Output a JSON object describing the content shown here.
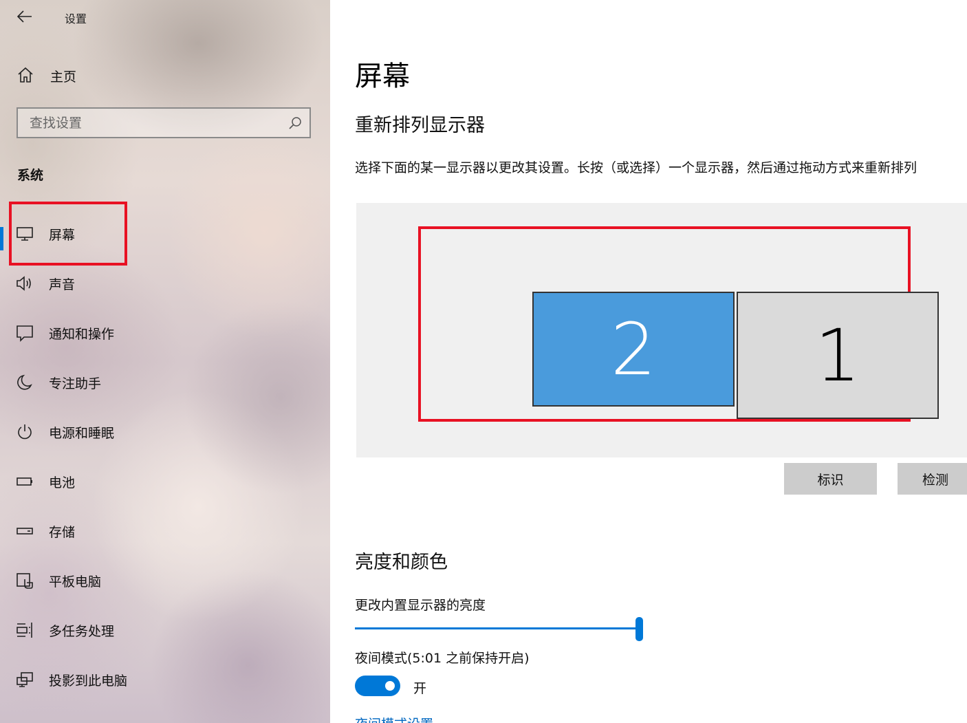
{
  "sidebar": {
    "app_title": "设置",
    "home_label": "主页",
    "search": {
      "placeholder": "查找设置"
    },
    "section_title": "系统",
    "items": [
      {
        "label": "屏幕",
        "icon": "monitor-icon",
        "active": true
      },
      {
        "label": "声音",
        "icon": "speaker-icon"
      },
      {
        "label": "通知和操作",
        "icon": "notification-icon"
      },
      {
        "label": "专注助手",
        "icon": "moon-icon"
      },
      {
        "label": "电源和睡眠",
        "icon": "power-icon"
      },
      {
        "label": "电池",
        "icon": "battery-icon"
      },
      {
        "label": "存储",
        "icon": "storage-icon"
      },
      {
        "label": "平板电脑",
        "icon": "tablet-icon"
      },
      {
        "label": "多任务处理",
        "icon": "multitasking-icon"
      },
      {
        "label": "投影到此电脑",
        "icon": "project-icon"
      }
    ]
  },
  "main": {
    "title": "屏幕",
    "rearrange": {
      "heading": "重新排列显示器",
      "description": "选择下面的某一显示器以更改其设置。长按（或选择）一个显示器，然后通过拖动方式来重新排列",
      "monitors": [
        {
          "number": "2",
          "selected": true
        },
        {
          "number": "1",
          "selected": false
        }
      ],
      "identify_label": "标识",
      "detect_label": "检测"
    },
    "brightness": {
      "heading": "亮度和颜色",
      "slider_label": "更改内置显示器的亮度",
      "slider_value_percent": 100,
      "night_mode_label": "夜间模式(5:01 之前保持开启)",
      "toggle_state": "开",
      "toggle_on": true,
      "night_settings_link": "夜间模式设置"
    }
  },
  "colors": {
    "accent": "#0078d7",
    "highlight_red": "#e81123",
    "selected_monitor": "#4a9bdc",
    "unselected_monitor": "#dadada"
  }
}
